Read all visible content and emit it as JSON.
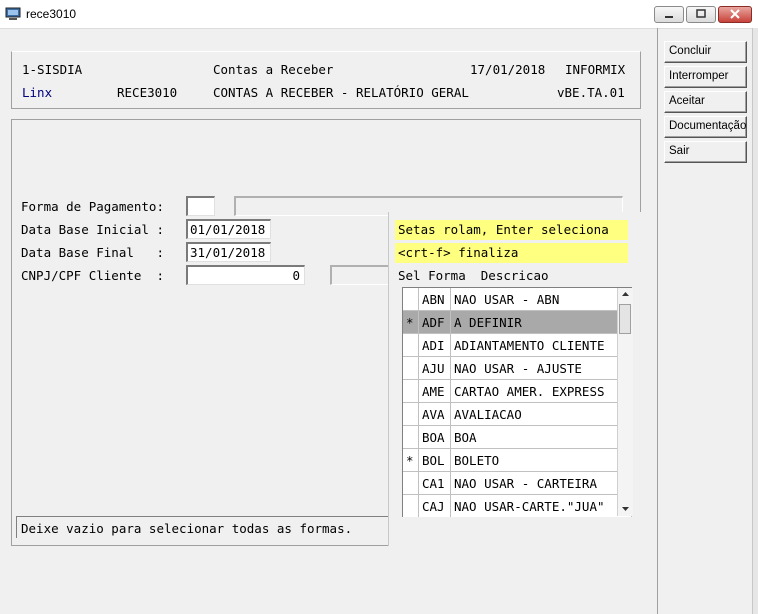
{
  "window": {
    "title": "rece3010"
  },
  "header": {
    "system": "1-SISDIA",
    "module": "Contas a Receber",
    "date": "17/01/2018",
    "db": "INFORMIX",
    "vendor": "Linx",
    "program": "RECE3010",
    "report_title": "CONTAS A RECEBER - RELATÓRIO GERAL",
    "version": "vBE.TA.01"
  },
  "sidebar": {
    "buttons": [
      "Concluir",
      "Interromper",
      "Aceitar",
      "Documentação",
      "Sair"
    ]
  },
  "form": {
    "forma_label": "Forma de Pagamento:",
    "forma_value": "",
    "dt_ini_label": "Data Base Inicial :",
    "dt_ini_value": "01/01/2018",
    "dt_fim_label": "Data Base Final   :",
    "dt_fim_value": "31/01/2018",
    "cnpj_label": "CNPJ/CPF Cliente  :",
    "cnpj_value": "0"
  },
  "popup": {
    "hint1": "Setas rolam, Enter seleciona",
    "hint2": "<crt-f> finaliza",
    "columns": "Sel Forma  Descricao",
    "rows": [
      {
        "sel": "",
        "code": "ABN",
        "desc": "NAO USAR - ABN"
      },
      {
        "sel": "*",
        "code": "ADF",
        "desc": "A DEFINIR"
      },
      {
        "sel": "",
        "code": "ADI",
        "desc": "ADIANTAMENTO CLIENTE"
      },
      {
        "sel": "",
        "code": "AJU",
        "desc": "NAO USAR - AJUSTE"
      },
      {
        "sel": "",
        "code": "AME",
        "desc": "CARTAO AMER. EXPRESS"
      },
      {
        "sel": "",
        "code": "AVA",
        "desc": "AVALIACAO"
      },
      {
        "sel": "",
        "code": "BOA",
        "desc": "BOA"
      },
      {
        "sel": "*",
        "code": "BOL",
        "desc": "BOLETO"
      },
      {
        "sel": "",
        "code": "CA1",
        "desc": "NAO USAR - CARTEIRA"
      },
      {
        "sel": "",
        "code": "CAJ",
        "desc": "NAO USAR-CARTE.\"JUA\""
      }
    ],
    "highlight_color": "#a9a9a9",
    "hint_color": "#ffff80"
  },
  "status": {
    "message": "Deixe vazio para selecionar todas as formas."
  }
}
